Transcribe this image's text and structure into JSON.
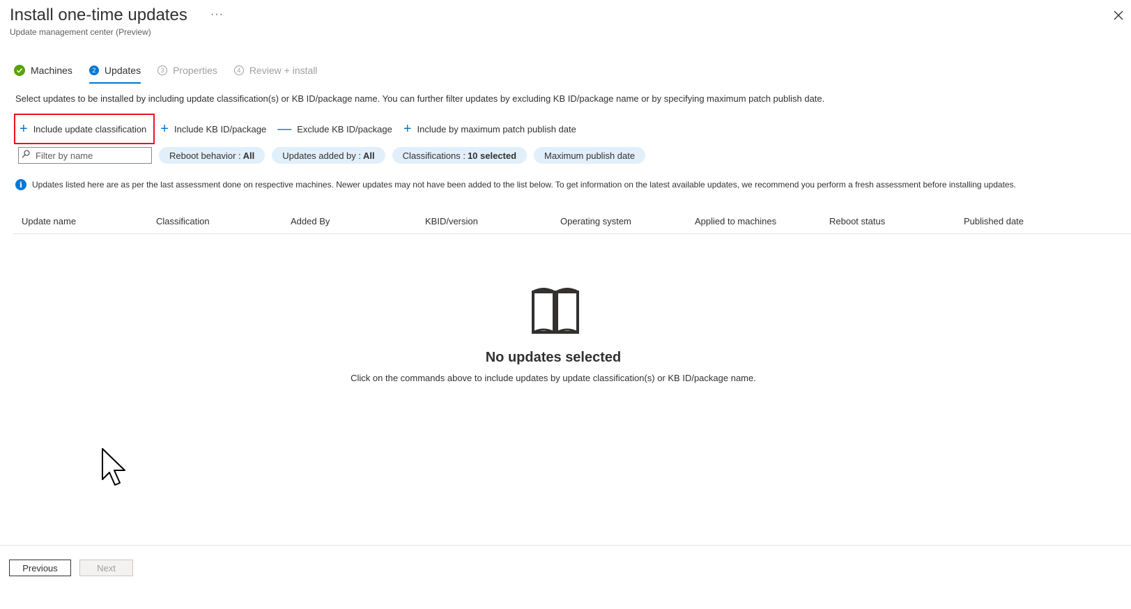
{
  "header": {
    "title": "Install one-time updates",
    "more_label": "···",
    "subtitle": "Update management center (Preview)",
    "close_icon": "close-icon"
  },
  "steps": [
    {
      "number": "",
      "label": "Machines",
      "state": "completed",
      "icon": "check-circle-icon"
    },
    {
      "number": "2",
      "label": "Updates",
      "state": "active"
    },
    {
      "number": "3",
      "label": "Properties",
      "state": "disabled"
    },
    {
      "number": "4",
      "label": "Review + install",
      "state": "disabled"
    }
  ],
  "description": "Select updates to be installed by including update classification(s) or KB ID/package name. You can further filter updates by excluding KB ID/package name or by specifying maximum patch publish date.",
  "commands": [
    {
      "icon": "+",
      "label": "Include update classification"
    },
    {
      "icon": "+",
      "label": "Include KB ID/package"
    },
    {
      "icon": "—",
      "label": "Exclude KB ID/package"
    },
    {
      "icon": "+",
      "label": "Include by maximum patch publish date"
    }
  ],
  "filters": {
    "search_placeholder": "Filter by name",
    "reboot_label": "Reboot behavior :",
    "reboot_value": "All",
    "added_by_label": "Updates added by :",
    "added_by_value": "All",
    "classifications_label": "Classifications :",
    "classifications_value": "10 selected",
    "max_date_label": "Maximum publish date"
  },
  "info_banner": "Updates listed here are as per the last assessment done on respective machines. Newer updates may not have been added to the list below. To get information on the latest available updates, we recommend you perform a fresh assessment before installing updates.",
  "table": {
    "columns": [
      "Update name",
      "Classification",
      "Added By",
      "KBID/version",
      "Operating system",
      "Applied to machines",
      "Reboot status",
      "Published date"
    ]
  },
  "empty_state": {
    "icon": "open-book-icon",
    "title": "No updates selected",
    "text": "Click on the commands above to include updates by update classification(s) or KB ID/package name."
  },
  "footer": {
    "previous_label": "Previous",
    "next_label": "Next"
  },
  "colors": {
    "accent": "#0078d4",
    "success": "#57a300",
    "highlight_border": "#e81123",
    "pill_bg": "#e1effa"
  }
}
